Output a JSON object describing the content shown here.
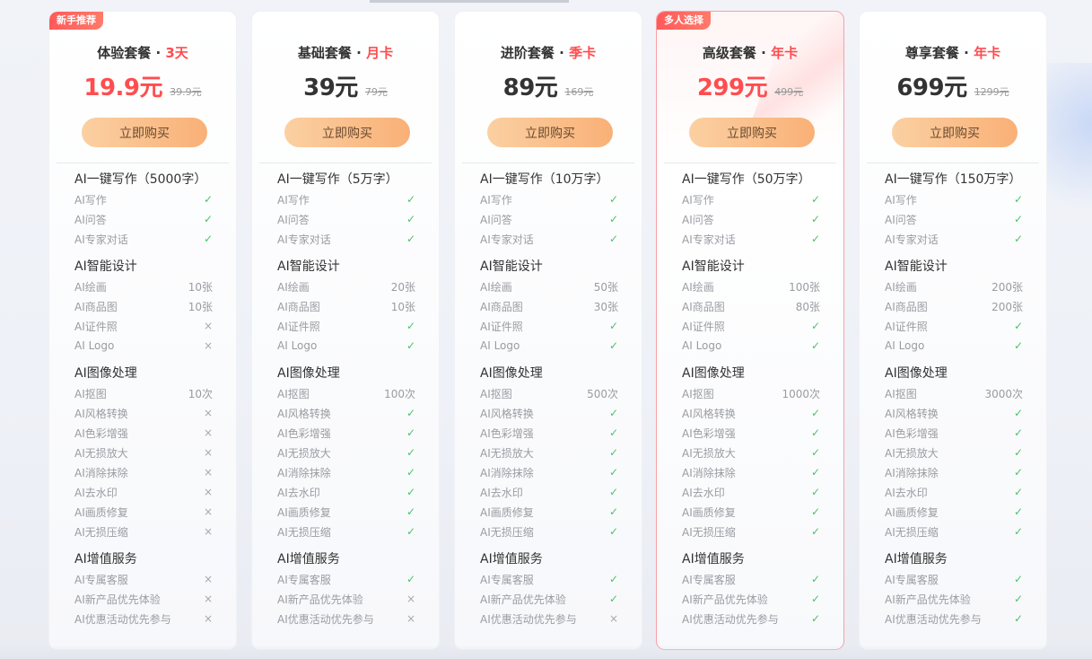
{
  "plans": [
    {
      "badge": "新手推荐",
      "name": "体验套餐",
      "sep": "·",
      "duration": "3天",
      "price": "19.9元",
      "price_red": true,
      "original": "39.9元",
      "button": "立即购买",
      "sections": [
        {
          "title": "AI一键写作（5000字）",
          "items": [
            {
              "label": "AI写作",
              "value": "✓"
            },
            {
              "label": "AI问答",
              "value": "✓"
            },
            {
              "label": "AI专家对话",
              "value": "✓"
            }
          ]
        },
        {
          "title": "AI智能设计",
          "items": [
            {
              "label": "AI绘画",
              "value": "10张"
            },
            {
              "label": "AI商品图",
              "value": "10张"
            },
            {
              "label": "AI证件照",
              "value": "×"
            },
            {
              "label": "AI Logo",
              "value": "×"
            }
          ]
        },
        {
          "title": "AI图像处理",
          "items": [
            {
              "label": "AI抠图",
              "value": "10次"
            },
            {
              "label": "AI风格转换",
              "value": "×"
            },
            {
              "label": "AI色彩增强",
              "value": "×"
            },
            {
              "label": "AI无损放大",
              "value": "×"
            },
            {
              "label": "AI消除抹除",
              "value": "×"
            },
            {
              "label": "AI去水印",
              "value": "×"
            },
            {
              "label": "AI画质修复",
              "value": "×"
            },
            {
              "label": "AI无损压缩",
              "value": "×"
            }
          ]
        },
        {
          "title": "AI增值服务",
          "items": [
            {
              "label": "AI专属客服",
              "value": "×"
            },
            {
              "label": "AI新产品优先体验",
              "value": "×"
            },
            {
              "label": "AI优惠活动优先参与",
              "value": "×"
            }
          ]
        }
      ]
    },
    {
      "badge": "",
      "name": "基础套餐",
      "sep": "·",
      "duration": "月卡",
      "price": "39元",
      "price_red": false,
      "original": "79元",
      "button": "立即购买",
      "sections": [
        {
          "title": "AI一键写作（5万字）",
          "items": [
            {
              "label": "AI写作",
              "value": "✓"
            },
            {
              "label": "AI问答",
              "value": "✓"
            },
            {
              "label": "AI专家对话",
              "value": "✓"
            }
          ]
        },
        {
          "title": "AI智能设计",
          "items": [
            {
              "label": "AI绘画",
              "value": "20张"
            },
            {
              "label": "AI商品图",
              "value": "10张"
            },
            {
              "label": "AI证件照",
              "value": "✓"
            },
            {
              "label": "AI Logo",
              "value": "✓"
            }
          ]
        },
        {
          "title": "AI图像处理",
          "items": [
            {
              "label": "AI抠图",
              "value": "100次"
            },
            {
              "label": "AI风格转换",
              "value": "✓"
            },
            {
              "label": "AI色彩增强",
              "value": "✓"
            },
            {
              "label": "AI无损放大",
              "value": "✓"
            },
            {
              "label": "AI消除抹除",
              "value": "✓"
            },
            {
              "label": "AI去水印",
              "value": "✓"
            },
            {
              "label": "AI画质修复",
              "value": "✓"
            },
            {
              "label": "AI无损压缩",
              "value": "✓"
            }
          ]
        },
        {
          "title": "AI增值服务",
          "items": [
            {
              "label": "AI专属客服",
              "value": "✓"
            },
            {
              "label": "AI新产品优先体验",
              "value": "×"
            },
            {
              "label": "AI优惠活动优先参与",
              "value": "×"
            }
          ]
        }
      ]
    },
    {
      "badge": "",
      "name": "进阶套餐",
      "sep": "·",
      "duration": "季卡",
      "price": "89元",
      "price_red": false,
      "original": "169元",
      "button": "立即购买",
      "sections": [
        {
          "title": "AI一键写作（10万字）",
          "items": [
            {
              "label": "AI写作",
              "value": "✓"
            },
            {
              "label": "AI问答",
              "value": "✓"
            },
            {
              "label": "AI专家对话",
              "value": "✓"
            }
          ]
        },
        {
          "title": "AI智能设计",
          "items": [
            {
              "label": "AI绘画",
              "value": "50张"
            },
            {
              "label": "AI商品图",
              "value": "30张"
            },
            {
              "label": "AI证件照",
              "value": "✓"
            },
            {
              "label": "AI Logo",
              "value": "✓"
            }
          ]
        },
        {
          "title": "AI图像处理",
          "items": [
            {
              "label": "AI抠图",
              "value": "500次"
            },
            {
              "label": "AI风格转换",
              "value": "✓"
            },
            {
              "label": "AI色彩增强",
              "value": "✓"
            },
            {
              "label": "AI无损放大",
              "value": "✓"
            },
            {
              "label": "AI消除抹除",
              "value": "✓"
            },
            {
              "label": "AI去水印",
              "value": "✓"
            },
            {
              "label": "AI画质修复",
              "value": "✓"
            },
            {
              "label": "AI无损压缩",
              "value": "✓"
            }
          ]
        },
        {
          "title": "AI增值服务",
          "items": [
            {
              "label": "AI专属客服",
              "value": "✓"
            },
            {
              "label": "AI新产品优先体验",
              "value": "✓"
            },
            {
              "label": "AI优惠活动优先参与",
              "value": "×"
            }
          ]
        }
      ]
    },
    {
      "badge": "多人选择",
      "name": "高级套餐",
      "sep": "·",
      "duration": "年卡",
      "price": "299元",
      "price_red": true,
      "original": "499元",
      "button": "立即购买",
      "featured": true,
      "sections": [
        {
          "title": "AI一键写作（50万字）",
          "items": [
            {
              "label": "AI写作",
              "value": "✓"
            },
            {
              "label": "AI问答",
              "value": "✓"
            },
            {
              "label": "AI专家对话",
              "value": "✓"
            }
          ]
        },
        {
          "title": "AI智能设计",
          "items": [
            {
              "label": "AI绘画",
              "value": "100张"
            },
            {
              "label": "AI商品图",
              "value": "80张"
            },
            {
              "label": "AI证件照",
              "value": "✓"
            },
            {
              "label": "AI Logo",
              "value": "✓"
            }
          ]
        },
        {
          "title": "AI图像处理",
          "items": [
            {
              "label": "AI抠图",
              "value": "1000次"
            },
            {
              "label": "AI风格转换",
              "value": "✓"
            },
            {
              "label": "AI色彩增强",
              "value": "✓"
            },
            {
              "label": "AI无损放大",
              "value": "✓"
            },
            {
              "label": "AI消除抹除",
              "value": "✓"
            },
            {
              "label": "AI去水印",
              "value": "✓"
            },
            {
              "label": "AI画质修复",
              "value": "✓"
            },
            {
              "label": "AI无损压缩",
              "value": "✓"
            }
          ]
        },
        {
          "title": "AI增值服务",
          "items": [
            {
              "label": "AI专属客服",
              "value": "✓"
            },
            {
              "label": "AI新产品优先体验",
              "value": "✓"
            },
            {
              "label": "AI优惠活动优先参与",
              "value": "✓"
            }
          ]
        }
      ]
    },
    {
      "badge": "",
      "name": "尊享套餐",
      "sep": "·",
      "duration": "年卡",
      "price": "699元",
      "price_red": false,
      "original": "1299元",
      "button": "立即购买",
      "sections": [
        {
          "title": "AI一键写作（150万字）",
          "items": [
            {
              "label": "AI写作",
              "value": "✓"
            },
            {
              "label": "AI问答",
              "value": "✓"
            },
            {
              "label": "AI专家对话",
              "value": "✓"
            }
          ]
        },
        {
          "title": "AI智能设计",
          "items": [
            {
              "label": "AI绘画",
              "value": "200张"
            },
            {
              "label": "AI商品图",
              "value": "200张"
            },
            {
              "label": "AI证件照",
              "value": "✓"
            },
            {
              "label": "AI Logo",
              "value": "✓"
            }
          ]
        },
        {
          "title": "AI图像处理",
          "items": [
            {
              "label": "AI抠图",
              "value": "3000次"
            },
            {
              "label": "AI风格转换",
              "value": "✓"
            },
            {
              "label": "AI色彩增强",
              "value": "✓"
            },
            {
              "label": "AI无损放大",
              "value": "✓"
            },
            {
              "label": "AI消除抹除",
              "value": "✓"
            },
            {
              "label": "AI去水印",
              "value": "✓"
            },
            {
              "label": "AI画质修复",
              "value": "✓"
            },
            {
              "label": "AI无损压缩",
              "value": "✓"
            }
          ]
        },
        {
          "title": "AI增值服务",
          "items": [
            {
              "label": "AI专属客服",
              "value": "✓"
            },
            {
              "label": "AI新产品优先体验",
              "value": "✓"
            },
            {
              "label": "AI优惠活动优先参与",
              "value": "✓"
            }
          ]
        }
      ]
    }
  ]
}
